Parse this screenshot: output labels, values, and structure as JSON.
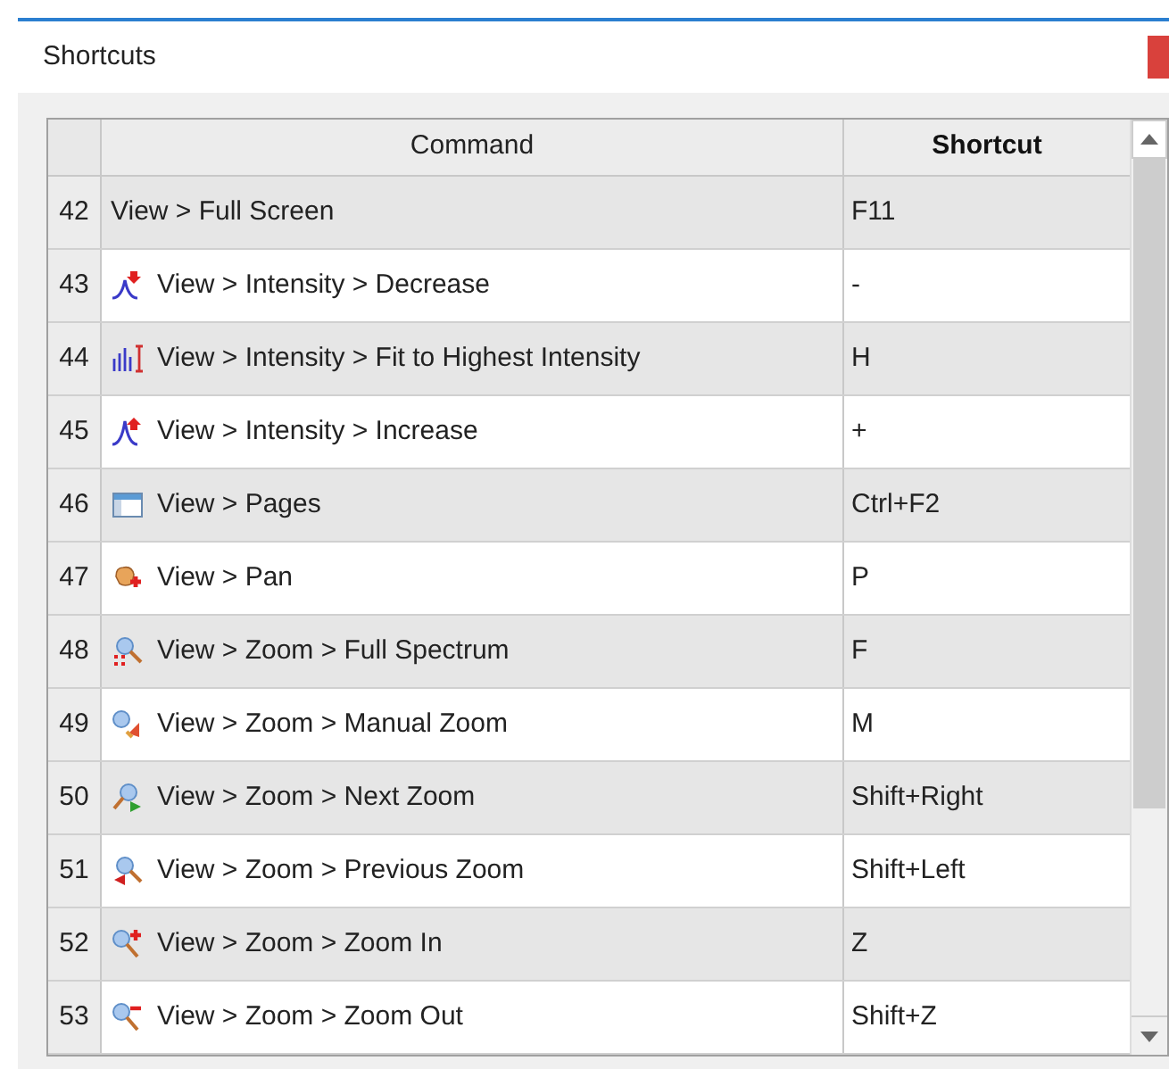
{
  "window": {
    "title": "Shortcuts"
  },
  "table": {
    "columns": [
      "Command",
      "Shortcut"
    ],
    "rows": [
      {
        "number": "42",
        "command": "View > Full Screen",
        "shortcut": "F11"
      },
      {
        "number": "43",
        "command": "View > Intensity > Decrease",
        "shortcut": "-"
      },
      {
        "number": "44",
        "command": "View > Intensity > Fit to Highest Intensity",
        "shortcut": "H"
      },
      {
        "number": "45",
        "command": "View > Intensity > Increase",
        "shortcut": "+"
      },
      {
        "number": "46",
        "command": "View > Pages",
        "shortcut": "Ctrl+F2"
      },
      {
        "number": "47",
        "command": "View > Pan",
        "shortcut": "P"
      },
      {
        "number": "48",
        "command": "View > Zoom > Full Spectrum",
        "shortcut": "F"
      },
      {
        "number": "49",
        "command": "View > Zoom > Manual Zoom",
        "shortcut": "M"
      },
      {
        "number": "50",
        "command": "View > Zoom > Next Zoom",
        "shortcut": "Shift+Right"
      },
      {
        "number": "51",
        "command": "View > Zoom > Previous Zoom",
        "shortcut": "Shift+Left"
      },
      {
        "number": "52",
        "command": "View > Zoom > Zoom In",
        "shortcut": "Z"
      },
      {
        "number": "53",
        "command": "View > Zoom > Zoom Out",
        "shortcut": "Shift+Z"
      }
    ]
  }
}
